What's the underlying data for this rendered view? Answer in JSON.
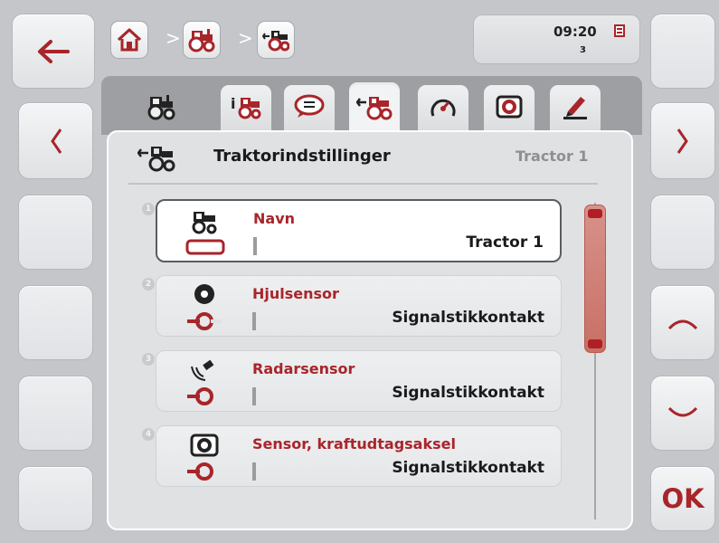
{
  "header": {
    "breadcrumb": [
      "home",
      "tractor",
      "tractor-settings"
    ],
    "separator": ">",
    "clock": "09:20",
    "counter": "3"
  },
  "softkeys": {
    "left": [
      "back-arrow",
      "previous",
      "",
      "",
      "",
      ""
    ],
    "right": [
      "",
      "next",
      "",
      "scroll-up",
      "scroll-down",
      "OK"
    ],
    "ok_label": "OK"
  },
  "tabs": [
    "tractor",
    "tractor-info",
    "messages",
    "tractor-settings",
    "gauge",
    "pto-sensor",
    "edit"
  ],
  "panel": {
    "title": "Traktorindstillinger",
    "subtitle": "Tractor 1"
  },
  "rows": [
    {
      "num": "1",
      "label": "Navn",
      "value": "Tractor 1",
      "icon": "tractor-name-icon"
    },
    {
      "num": "2",
      "label": "Hjulsensor",
      "value": "Signalstikkontakt",
      "icon": "wheel-sensor-icon"
    },
    {
      "num": "3",
      "label": "Radarsensor",
      "value": "Signalstikkontakt",
      "icon": "radar-sensor-icon"
    },
    {
      "num": "4",
      "label": "Sensor, kraftudtagsaksel",
      "value": "Signalstikkontakt",
      "icon": "pto-sensor-icon"
    }
  ],
  "colors": {
    "accent": "#a8252a",
    "background": "#c4c6ca",
    "panel": "#dfe1e3"
  }
}
